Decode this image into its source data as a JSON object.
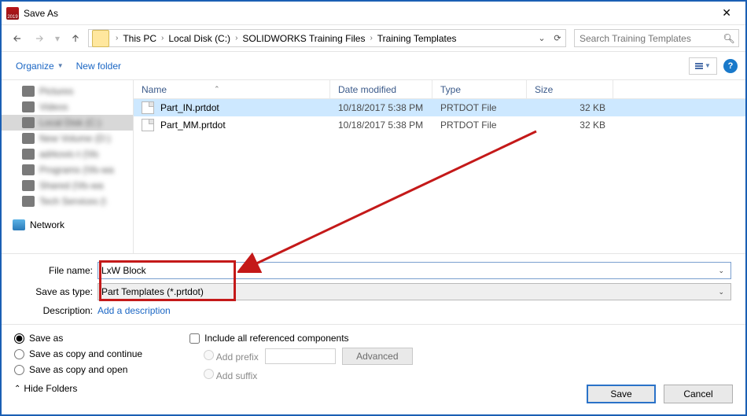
{
  "window": {
    "title": "Save As"
  },
  "nav": {
    "breadcrumb": [
      "This PC",
      "Local Disk (C:)",
      "SOLIDWORKS Training Files",
      "Training Templates"
    ],
    "search_placeholder": "Search Training Templates"
  },
  "toolbar": {
    "organize": "Organize",
    "newfolder": "New folder"
  },
  "sidebar": {
    "items": [
      {
        "label": "Pictures"
      },
      {
        "label": "Videos"
      },
      {
        "label": "Local Disk (C:)"
      },
      {
        "label": "New Volume (D:)"
      },
      {
        "label": "adrkovic-t (\\\\fs"
      },
      {
        "label": "Programs (\\\\fs-wa"
      },
      {
        "label": "Shared (\\\\fs-wa"
      },
      {
        "label": "Tech Services (\\"
      }
    ],
    "network": "Network"
  },
  "columns": {
    "name": "Name",
    "date": "Date modified",
    "type": "Type",
    "size": "Size"
  },
  "files": [
    {
      "name": "Part_IN.prtdot",
      "date": "10/18/2017 5:38 PM",
      "type": "PRTDOT File",
      "size": "32 KB",
      "selected": true
    },
    {
      "name": "Part_MM.prtdot",
      "date": "10/18/2017 5:38 PM",
      "type": "PRTDOT File",
      "size": "32 KB",
      "selected": false
    }
  ],
  "form": {
    "filename_label": "File name:",
    "filename_value": "LxW Block",
    "savetype_label": "Save as type:",
    "savetype_value": "Part Templates (*.prtdot)",
    "description_label": "Description:",
    "description_link": "Add a description"
  },
  "options": {
    "save_as": "Save as",
    "save_copy_cont": "Save as copy and continue",
    "save_copy_open": "Save as copy and open",
    "include_ref": "Include all referenced components",
    "add_prefix": "Add prefix",
    "add_suffix": "Add suffix",
    "advanced": "Advanced",
    "hide_folders": "Hide Folders"
  },
  "buttons": {
    "save": "Save",
    "cancel": "Cancel"
  }
}
